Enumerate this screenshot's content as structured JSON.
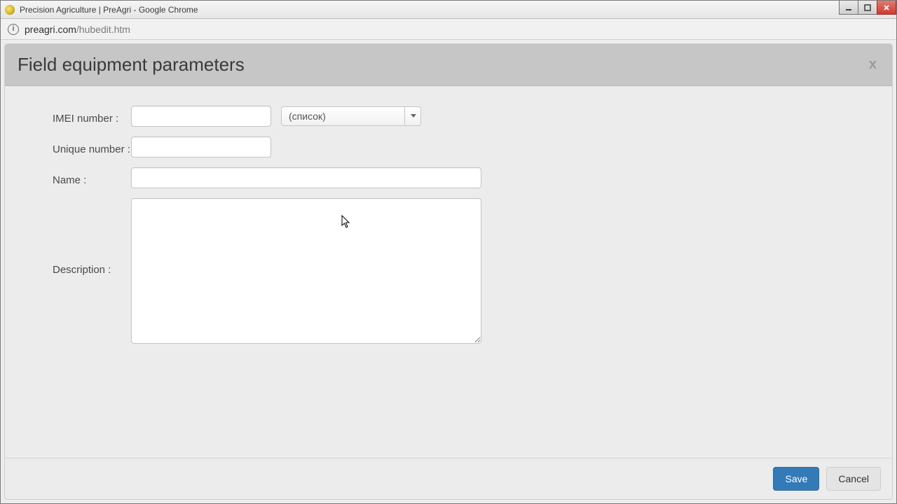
{
  "browser": {
    "tab_title": "Precision Agriculture | PreAgri - Google Chrome",
    "url_host": "preagri.com",
    "url_path": "/hubedit.htm"
  },
  "panel": {
    "title": "Field equipment parameters",
    "close_glyph": "x"
  },
  "form": {
    "imei_label": "IMEI number :",
    "imei_value": "",
    "imei_list_selected": "(список)",
    "unique_label": "Unique number :",
    "unique_value": "",
    "name_label": "Name :",
    "name_value": "",
    "description_label": "Description :",
    "description_value": ""
  },
  "footer": {
    "save_label": "Save",
    "cancel_label": "Cancel"
  }
}
